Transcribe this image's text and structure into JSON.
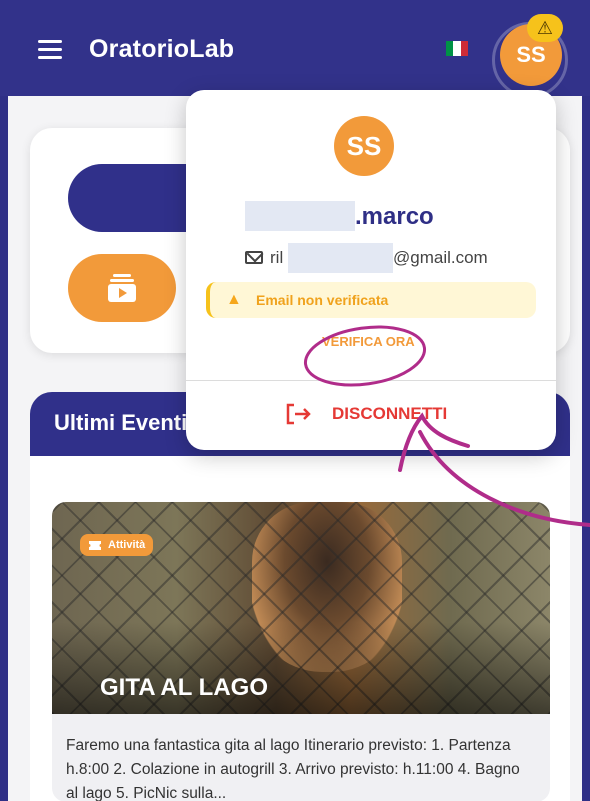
{
  "app_bar": {
    "title": "OratorioLab",
    "avatar_initials": "SS",
    "warning_badge": "⚠",
    "flag_colors": [
      "#009246",
      "#ffffff",
      "#ce2b37"
    ]
  },
  "events_section": {
    "title": "Ultimi Eventi"
  },
  "event_card": {
    "tag": "Attività",
    "title": "GITA AL LAGO",
    "description": "Faremo una fantastica gita al lago Itinerario previsto: 1. Partenza h.8:00 2. Colazione in autogrill 3. Arrivo previsto: h.11:00 4. Bagno al lago 5. PicNic sulla..."
  },
  "user_menu": {
    "avatar_initials": "SS",
    "name_suffix": ".marco",
    "email_prefix": "ril",
    "email_suffix": "@gmail.com",
    "warning_text": "Email non verificata",
    "verify_label": "VERIFICA ORA",
    "logout_label": "DISCONNETTI"
  },
  "colors": {
    "primary": "#30308a",
    "accent": "#f29a3a",
    "danger": "#e53935",
    "warning": "#f6c21b",
    "annotation": "#b02c8a"
  }
}
